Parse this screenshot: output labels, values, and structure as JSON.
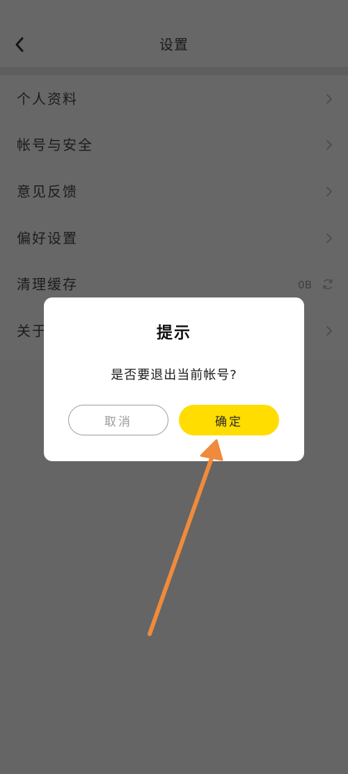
{
  "header": {
    "title": "设置"
  },
  "menu": {
    "items": [
      {
        "label": "个人资料"
      },
      {
        "label": "帐号与安全"
      },
      {
        "label": "意见反馈"
      },
      {
        "label": "偏好设置"
      },
      {
        "label": "清理缓存",
        "value": "0B"
      },
      {
        "label": "关于"
      }
    ]
  },
  "dialog": {
    "title": "提示",
    "message": "是否要退出当前帐号?",
    "cancel_label": "取消",
    "confirm_label": "确定"
  },
  "colors": {
    "accent": "#ffdd00",
    "overlay_background": "#646564",
    "annotation_arrow": "#f08a3c"
  },
  "icons": {
    "back": "chevron-left-icon",
    "row_arrow": "chevron-right-icon",
    "cache": "refresh-icon"
  }
}
